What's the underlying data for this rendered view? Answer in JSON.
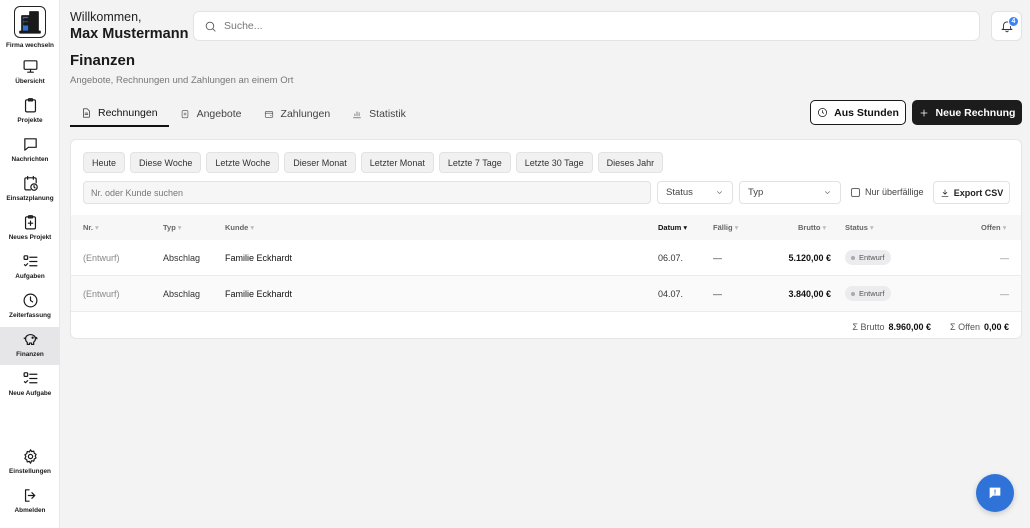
{
  "sidebar": {
    "company_switch": "Firma wechseln",
    "items": [
      {
        "label": "Übersicht"
      },
      {
        "label": "Projekte"
      },
      {
        "label": "Nachrichten"
      },
      {
        "label": "Einsatzplanung"
      },
      {
        "label": "Neues Projekt"
      },
      {
        "label": "Aufgaben"
      },
      {
        "label": "Zeiterfassung"
      },
      {
        "label": "Finanzen"
      },
      {
        "label": "Neue Aufgabe"
      },
      {
        "label": "Einstellungen"
      },
      {
        "label": "Abmelden"
      }
    ]
  },
  "header": {
    "welcome": "Willkommen,",
    "user_name": "Max Mustermann",
    "search_placeholder": "Suche...",
    "notifications_count": "4"
  },
  "page": {
    "title": "Finanzen",
    "subtitle": "Angebote, Rechnungen und Zahlungen an einem Ort"
  },
  "tabs": [
    {
      "label": "Rechnungen"
    },
    {
      "label": "Angebote"
    },
    {
      "label": "Zahlungen"
    },
    {
      "label": "Statistik"
    }
  ],
  "actions": {
    "from_hours": "Aus Stunden",
    "new_invoice": "Neue Rechnung"
  },
  "filters": {
    "chips": [
      "Heute",
      "Diese Woche",
      "Letzte Woche",
      "Dieser Monat",
      "Letzter Monat",
      "Letzte 7 Tage",
      "Letzte 30 Tage",
      "Dieses Jahr"
    ],
    "search_placeholder": "Nr. oder Kunde suchen",
    "status_select": "Status",
    "type_select": "Typ",
    "overdue_only": "Nur überfällige",
    "export_csv": "Export CSV"
  },
  "table": {
    "columns": {
      "nr": "Nr.",
      "typ": "Typ",
      "kunde": "Kunde",
      "datum": "Datum",
      "faellig": "Fällig",
      "brutto": "Brutto",
      "status": "Status",
      "offen": "Offen"
    },
    "rows": [
      {
        "nr": "(Entwurf)",
        "typ": "Abschlag",
        "kunde": "Familie Eckhardt",
        "datum": "06.07.",
        "faellig": "—",
        "brutto": "5.120,00 €",
        "status": "Entwurf",
        "offen": "—"
      },
      {
        "nr": "(Entwurf)",
        "typ": "Abschlag",
        "kunde": "Familie Eckhardt",
        "datum": "04.07.",
        "faellig": "—",
        "brutto": "3.840,00 €",
        "status": "Entwurf",
        "offen": "—"
      }
    ],
    "totals": {
      "brutto_label": "Σ Brutto",
      "brutto_value": "8.960,00 €",
      "offen_label": "Σ Offen",
      "offen_value": "0,00 €"
    }
  }
}
